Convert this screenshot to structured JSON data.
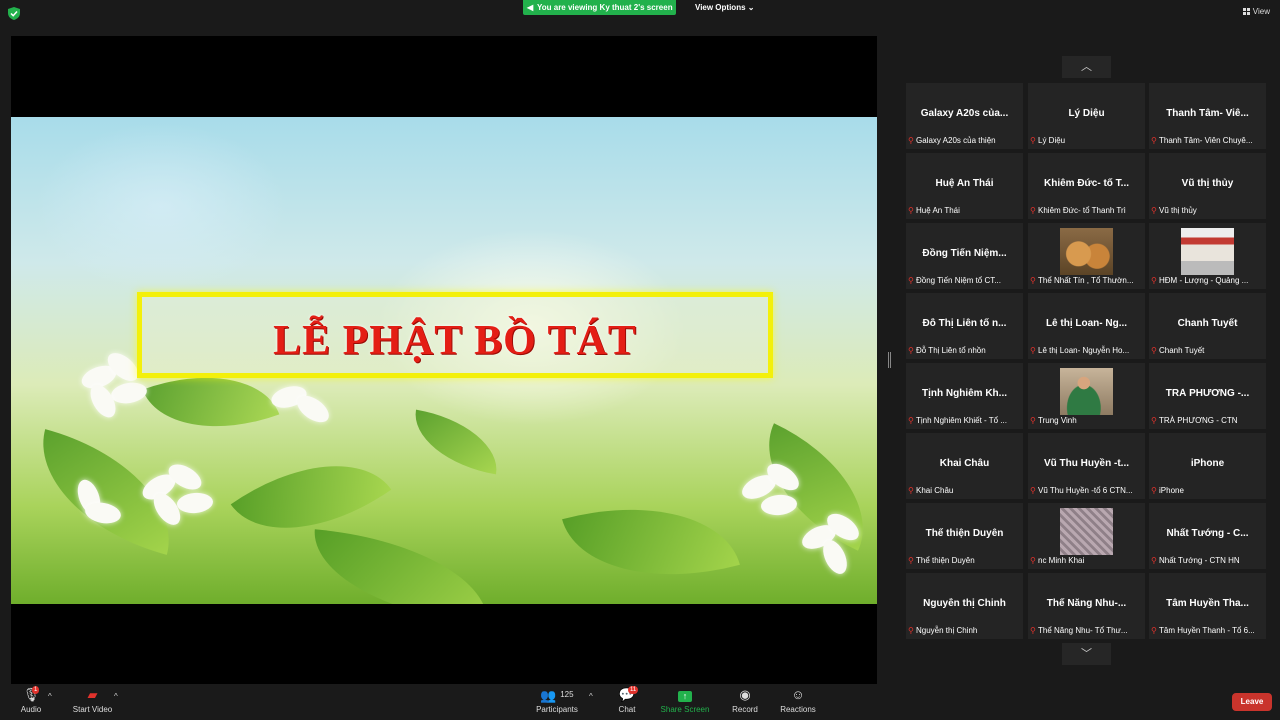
{
  "topbar": {
    "viewing_label": "You are viewing Ky thuat 2's screen",
    "view_options_label": "View Options ⌄",
    "view_label": "View"
  },
  "slide": {
    "title": "LỄ PHẬT BỒ TÁT"
  },
  "participants_tiles": [
    {
      "big": "Galaxy A20s của...",
      "caption": "Galaxy A20s của thiện"
    },
    {
      "big": "Lý Diệu",
      "caption": "Lý Diệu"
    },
    {
      "big": "Thanh Tâm- Viê...",
      "caption": "Thanh Tâm- Viên Chuyê..."
    },
    {
      "big": "Huệ An Thái",
      "caption": "Huệ An Thái"
    },
    {
      "big": "Khiêm Đức- tổ T...",
      "caption": "Khiêm Đức- tổ Thanh Trì"
    },
    {
      "big": "Vũ thị thủy",
      "caption": "Vũ thị thủy"
    },
    {
      "big": "Đồng Tiến Niệm...",
      "caption": "Đồng Tiến Niệm tổ CT..."
    },
    {
      "big": "",
      "caption": "Thể Nhất Tín , Tổ Thườn...",
      "thumb": "cat"
    },
    {
      "big": "",
      "caption": "HĐM - Lượng - Quảng ...",
      "thumb": "gate"
    },
    {
      "big": "Đỗ Thị Liên tổ n...",
      "caption": "Đỗ Thị Liên tổ nhồn"
    },
    {
      "big": "Lê thị Loan- Ng...",
      "caption": "Lê thị Loan- Nguyễn Ho..."
    },
    {
      "big": "Chanh Tuyết",
      "caption": "Chanh Tuyết"
    },
    {
      "big": "Tịnh Nghiêm Kh...",
      "caption": "Tịnh Nghiêm Khiết - Tổ ..."
    },
    {
      "big": "",
      "caption": "Trung Vinh",
      "thumb": "man"
    },
    {
      "big": "TRÀ PHƯƠNG -...",
      "caption": "TRÀ PHƯƠNG - CTN"
    },
    {
      "big": "Khai Châu",
      "caption": "Khai Châu"
    },
    {
      "big": "Vũ Thu Huyền -t...",
      "caption": "Vũ Thu Huyền -tổ 6 CTN..."
    },
    {
      "big": "iPhone",
      "caption": "iPhone"
    },
    {
      "big": "Thể thiện Duyên",
      "caption": "Thể thiện Duyên"
    },
    {
      "big": "",
      "caption": "nc Minh Khai",
      "thumb": "flow"
    },
    {
      "big": "Nhất Tướng - C...",
      "caption": "Nhất Tướng - CTN HN"
    },
    {
      "big": "Nguyễn thị Chinh",
      "caption": "Nguyễn thị Chinh"
    },
    {
      "big": "Thể Năng Nhu-...",
      "caption": "Thể Năng Nhu- Tổ Thư..."
    },
    {
      "big": "Tâm Huyền Tha...",
      "caption": "Tâm Huyền Thanh - Tổ 6..."
    }
  ],
  "toolbar": {
    "audio_label": "Audio",
    "audio_badge": "1",
    "video_label": "Start Video",
    "participants_label": "Participants",
    "participants_count": "125",
    "chat_label": "Chat",
    "chat_badge": "11",
    "share_label": "Share Screen",
    "record_label": "Record",
    "reactions_label": "Reactions",
    "leave_label": "Leave"
  },
  "colors": {
    "accent_green": "#22b14c",
    "leave_red": "#c9342c",
    "banner_yellow": "#f3f00a",
    "title_red": "#e41e15"
  }
}
